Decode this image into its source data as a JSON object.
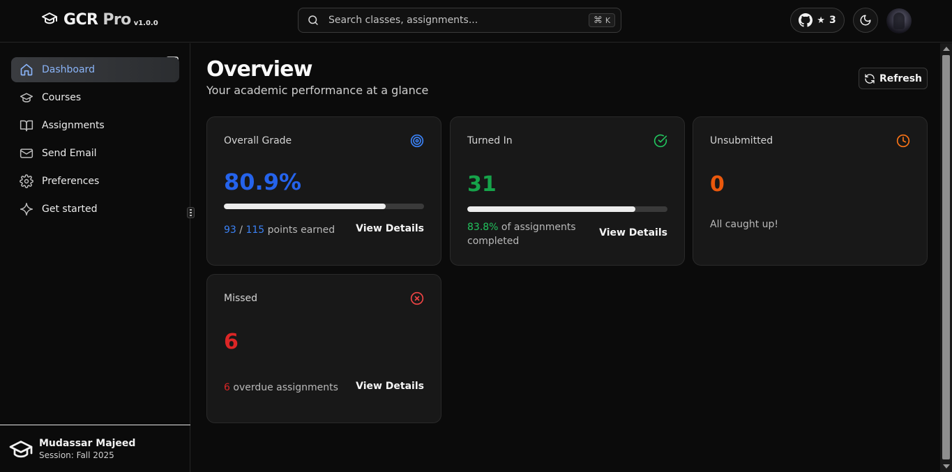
{
  "header": {
    "logo_main": "GCR",
    "logo_pro": " Pro",
    "version": "v1.0.0",
    "search_placeholder": "Search classes, assignments...",
    "shortcut_cmd": "⌘",
    "shortcut_key": "K",
    "github_star_icon": "★",
    "github_stars": "3"
  },
  "sidebar": {
    "items": [
      {
        "label": "Dashboard",
        "icon": "home-icon",
        "active": true
      },
      {
        "label": "Courses",
        "icon": "graduation-cap-icon"
      },
      {
        "label": "Assignments",
        "icon": "book-open-icon"
      },
      {
        "label": "Send Email",
        "icon": "mail-icon"
      },
      {
        "label": "Preferences",
        "icon": "gear-icon"
      },
      {
        "label": "Get started",
        "icon": "sparkle-icon"
      }
    ],
    "user": {
      "name": "Mudassar Majeed",
      "session": "Session: Fall 2025"
    }
  },
  "main": {
    "title": "Overview",
    "subtitle": "Your academic performance at a glance",
    "refresh_label": "Refresh",
    "cards": {
      "overall": {
        "title": "Overall Grade",
        "value": "80.9%",
        "points_earned": "93",
        "separator": " / ",
        "points_total": "115",
        "suffix": " points earned",
        "progress": 0.809,
        "action": "View Details"
      },
      "turned_in": {
        "title": "Turned In",
        "value": "31",
        "percent": "83.8%",
        "suffix": " of assignments completed",
        "progress": 0.838,
        "action": "View Details"
      },
      "unsubmitted": {
        "title": "Unsubmitted",
        "value": "0",
        "message": "All caught up!"
      },
      "missed": {
        "title": "Missed",
        "value": "6",
        "count": "6",
        "suffix": " overdue assignments",
        "action": "View Details"
      }
    }
  },
  "colors": {
    "accent_blue": "#2563eb",
    "success_green": "#16a34a",
    "warning_orange": "#ea580c",
    "danger_red": "#dc2626",
    "active_nav_text": "#8ab4f8"
  }
}
